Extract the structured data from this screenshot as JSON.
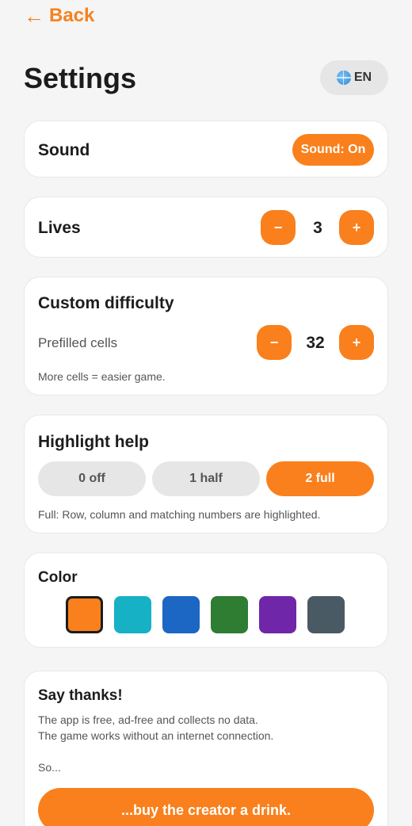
{
  "header": {
    "back_arrow": "←",
    "back_label": "Back",
    "title": "Settings",
    "language_icon": "globe-icon",
    "language_label": "EN"
  },
  "sound": {
    "title": "Sound",
    "toggle_label": "Sound: On"
  },
  "lives": {
    "title": "Lives",
    "minus": "−",
    "value": "3",
    "plus": "+"
  },
  "difficulty": {
    "title": "Custom difficulty",
    "prefilled_label": "Prefilled cells",
    "minus": "−",
    "value": "32",
    "plus": "+",
    "hint": "More cells = easier game."
  },
  "highlight": {
    "title": "Highlight help",
    "options": [
      {
        "label": "0 off",
        "selected": false
      },
      {
        "label": "1 half",
        "selected": false
      },
      {
        "label": "2 full",
        "selected": true
      }
    ],
    "description": "Full: Row, column and matching numbers are highlighted."
  },
  "color": {
    "title": "Color",
    "swatches": [
      "#f9801c",
      "#16b1c5",
      "#1c66c4",
      "#2e7d32",
      "#7026a8",
      "#4a5a64"
    ],
    "selected_index": 0
  },
  "thanks": {
    "title": "Say thanks!",
    "line1": "The app is free, ad-free and collects no data.",
    "line2": "The game works without an internet connection.",
    "line3": "So...",
    "button_label": "...buy the creator a drink."
  },
  "colors": {
    "accent": "#f9801c",
    "background": "#f5f5f5",
    "card": "#ffffff"
  }
}
